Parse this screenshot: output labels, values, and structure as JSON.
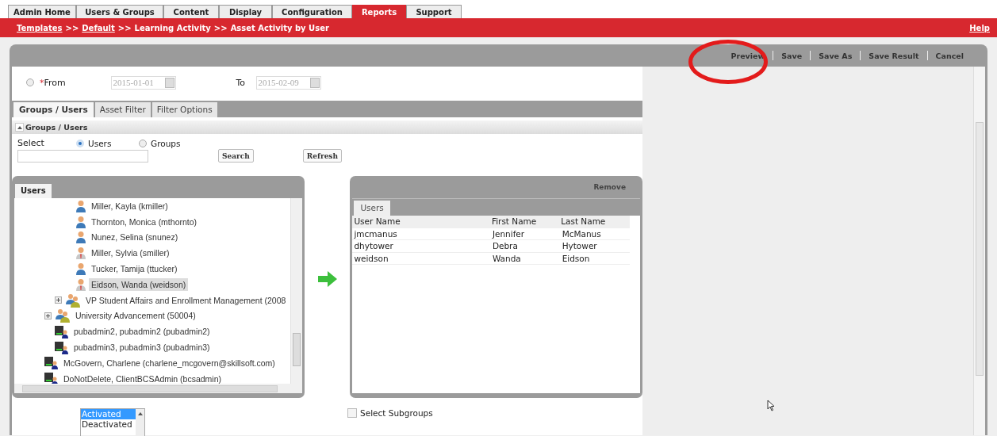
{
  "top_tabs": [
    {
      "label": "Admin Home",
      "selected": false
    },
    {
      "label": "Users & Groups",
      "selected": false
    },
    {
      "label": "Content",
      "selected": false
    },
    {
      "label": "Display",
      "selected": false
    },
    {
      "label": "Configuration",
      "selected": false
    },
    {
      "label": "Reports",
      "selected": true
    },
    {
      "label": "Support",
      "selected": false
    }
  ],
  "breadcrumb": [
    {
      "text": "Templates",
      "kind": "link"
    },
    {
      "text": ">>",
      "kind": "sep"
    },
    {
      "text": "Default",
      "kind": "link"
    },
    {
      "text": ">>",
      "kind": "sep"
    },
    {
      "text": "Learning Activity",
      "kind": "text"
    },
    {
      "text": ">>",
      "kind": "sep"
    },
    {
      "text": "Asset Activity by User",
      "kind": "text"
    }
  ],
  "help": "Help",
  "toolbar": [
    "Preview",
    "Save",
    "Save As",
    "Save Result",
    "Cancel"
  ],
  "date_range": {
    "selected": false,
    "required_mark": "*",
    "from_label": "From",
    "from_value": "2015-01-01",
    "to_label": "To",
    "to_value": "2015-02-09"
  },
  "filter_tabs": [
    {
      "label": "Groups / Users",
      "selected": true
    },
    {
      "label": "Asset Filter",
      "selected": false
    },
    {
      "label": "Filter Options",
      "selected": false
    }
  ],
  "section": {
    "title": "Groups / Users",
    "expanded": true
  },
  "select": {
    "label": "Select",
    "options": [
      {
        "label": "Users",
        "selected": true
      },
      {
        "label": "Groups",
        "selected": false
      }
    ]
  },
  "search_button": "Search",
  "refresh_button": "Refresh",
  "tree": {
    "tab": "Users",
    "items": [
      {
        "children": [
          {
            "children": [
              {
                "children": [
                  {
                    "label": "Miller, Kayla (kmiller)",
                    "kind": "user",
                    "selected": false
                  },
                  {
                    "label": "Thornton, Monica (mthornto)",
                    "kind": "user",
                    "selected": false
                  },
                  {
                    "label": "Nunez, Selina (snunez)",
                    "kind": "user",
                    "selected": false
                  },
                  {
                    "label": "Miller, Sylvia (smiller)",
                    "kind": "user-tie",
                    "selected": false
                  },
                  {
                    "label": "Tucker, Tamija (ttucker)",
                    "kind": "user",
                    "selected": false
                  },
                  {
                    "label": "Eidson, Wanda (weidson)",
                    "kind": "user-tie",
                    "selected": true
                  }
                ]
              },
              {
                "label": "VP Student Affairs and Enrollment Management (2008",
                "kind": "group",
                "expanded": false,
                "selected": false
              }
            ]
          },
          {
            "label": "University Advancement (50004)",
            "kind": "group",
            "expanded": false,
            "selected": false
          },
          {
            "label": "pubadmin2, pubadmin2 (pubadmin2)",
            "kind": "admin",
            "selected": false
          },
          {
            "label": "pubadmin3, pubadmin3 (pubadmin3)",
            "kind": "admin",
            "selected": false
          }
        ]
      },
      {
        "label": "McGovern, Charlene (charlene_mcgovern@skillsoft.com)",
        "kind": "admin",
        "selected": false
      },
      {
        "label": "DoNotDelete, ClientBCSAdmin (bcsadmin)",
        "kind": "admin",
        "selected": false
      }
    ]
  },
  "selected_panel": {
    "remove": "Remove",
    "tab": "Users",
    "columns": [
      "User Name",
      "First Name",
      "Last Name"
    ],
    "rows": [
      [
        "jmcmanus",
        "Jennifer",
        "McManus"
      ],
      [
        "dhytower",
        "Debra",
        "Hytower"
      ],
      [
        "weidson",
        "Wanda",
        "Eidson"
      ]
    ]
  },
  "status_list": [
    {
      "label": "Activated",
      "selected": true
    },
    {
      "label": "Deactivated",
      "selected": false
    }
  ],
  "subgroups": {
    "label": "Select Subgroups",
    "checked": false
  }
}
